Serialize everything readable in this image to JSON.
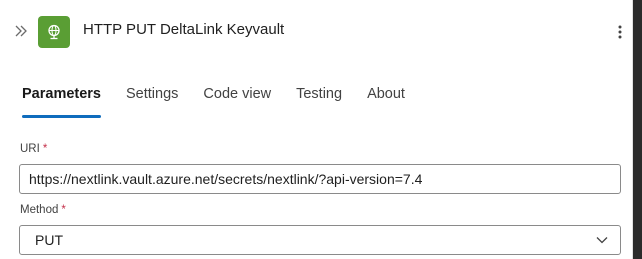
{
  "header": {
    "title": "HTTP PUT DeltaLink Keyvault",
    "action_icon": "globe-icon",
    "action_icon_color": "#5a9e34",
    "accent_color": "#0f6cbd"
  },
  "tabs": [
    {
      "label": "Parameters",
      "active": true
    },
    {
      "label": "Settings",
      "active": false
    },
    {
      "label": "Code view",
      "active": false
    },
    {
      "label": "Testing",
      "active": false
    },
    {
      "label": "About",
      "active": false
    }
  ],
  "fields": {
    "uri": {
      "label": "URI",
      "required_mark": "*",
      "value": "https://nextlink.vault.azure.net/secrets/nextlink/?api-version=7.4"
    },
    "method": {
      "label": "Method",
      "required_mark": "*",
      "value": "PUT"
    }
  }
}
